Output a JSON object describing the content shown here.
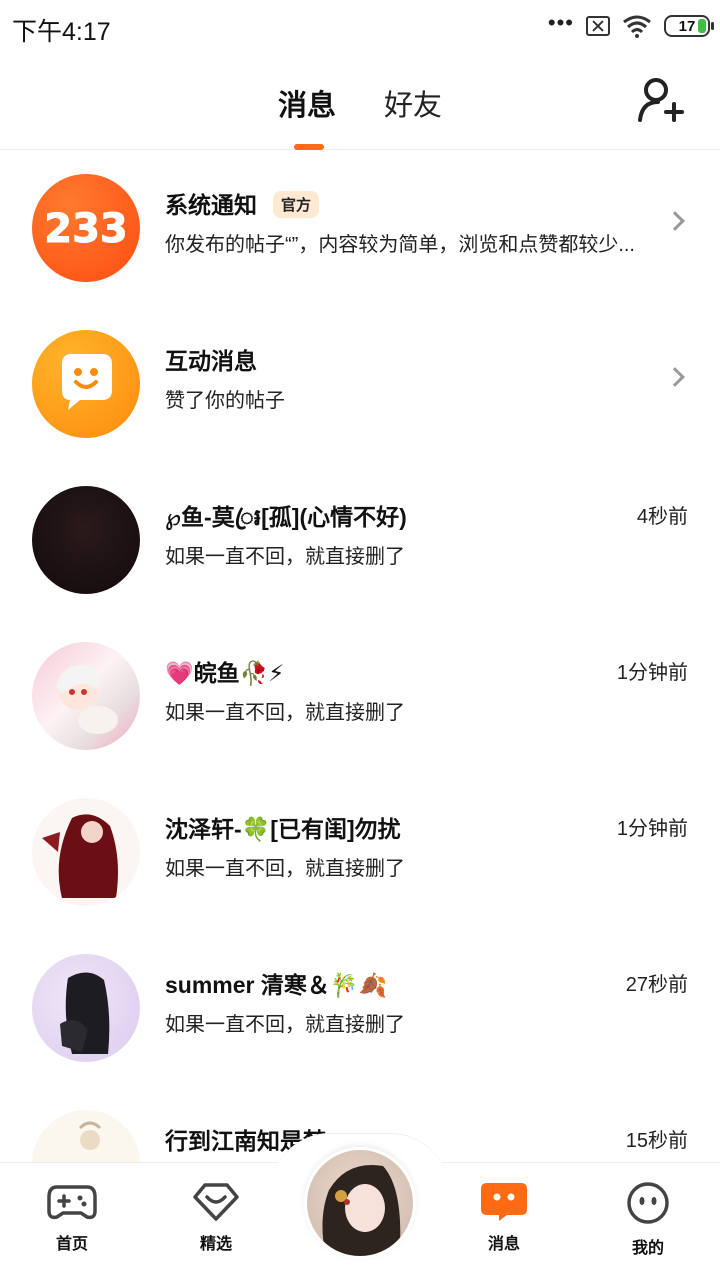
{
  "status_bar": {
    "time": "下午4:17",
    "battery": "17"
  },
  "header": {
    "tabs": [
      {
        "label": "消息",
        "active": true
      },
      {
        "label": "好友",
        "active": false
      }
    ],
    "add_friend_icon": "add-user-icon",
    "accent_color": "#ff6a13"
  },
  "messages": [
    {
      "name": "系统通知",
      "badge": "官方",
      "preview": "你发布的帖子“”，内容较为简单，浏览和点赞都较少...",
      "time": "",
      "avatar_text": "233",
      "avatar_color": "#ff5a1f"
    },
    {
      "name": "互动消息",
      "badge": "",
      "preview": "赞了你的帖子",
      "time": "",
      "avatar_icon": "chat-bubble-face-icon",
      "avatar_color": "#ff9a12"
    },
    {
      "name": "℘鱼-莫ꦿ៛[孤](心情不好)",
      "preview": "如果一直不回，就直接删了",
      "time": "4秒前"
    },
    {
      "name": "💗皖鱼🥀⚡",
      "preview": "如果一直不回，就直接删了",
      "time": "1分钟前"
    },
    {
      "name": "沈泽轩-🍀[已有闺]勿扰",
      "preview": "如果一直不回，就直接删了",
      "time": "1分钟前"
    },
    {
      "name": "summer 清寒＆🎋🍂",
      "preview": "如果一直不回，就直接删了",
      "time": "27秒前"
    },
    {
      "name": "行到江南知是梦",
      "preview": "",
      "time": "15秒前"
    }
  ],
  "bottom_nav": {
    "home": "首页",
    "picks": "精选",
    "messages": "消息",
    "me": "我的"
  }
}
